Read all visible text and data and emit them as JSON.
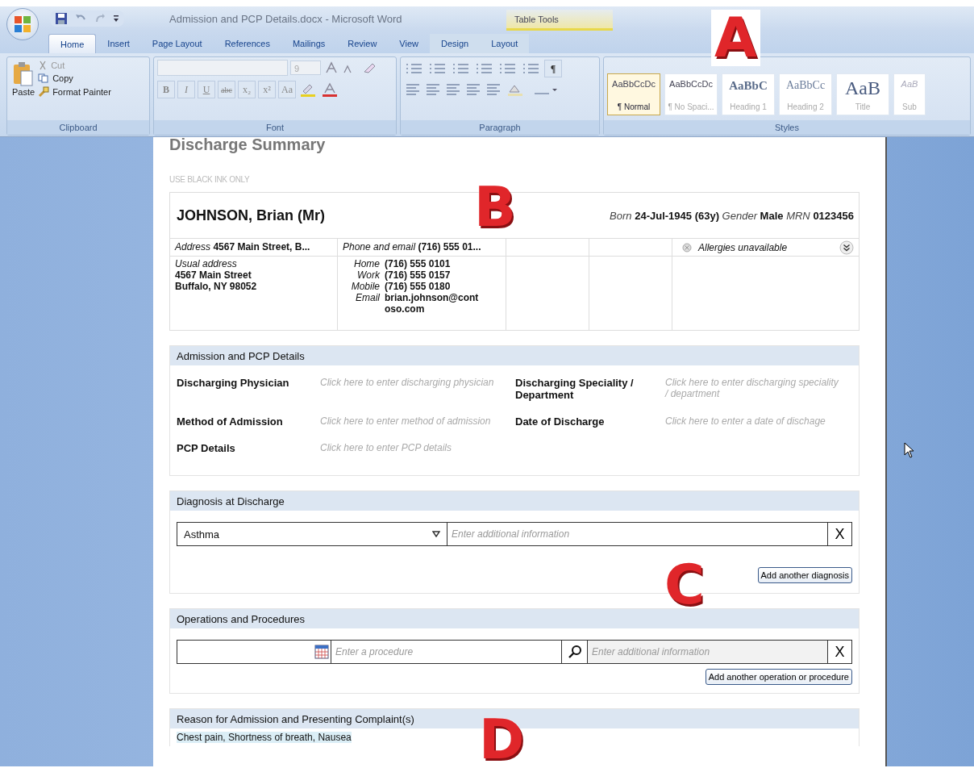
{
  "title_bar": {
    "title": "Admission and PCP Details.docx - Microsoft Word",
    "context_group": "Table Tools"
  },
  "ribbon_tabs": [
    {
      "label": "Home",
      "selected": true,
      "contextual": false
    },
    {
      "label": "Insert",
      "selected": false,
      "contextual": false
    },
    {
      "label": "Page Layout",
      "selected": false,
      "contextual": false
    },
    {
      "label": "References",
      "selected": false,
      "contextual": false
    },
    {
      "label": "Mailings",
      "selected": false,
      "contextual": false
    },
    {
      "label": "Review",
      "selected": false,
      "contextual": false
    },
    {
      "label": "View",
      "selected": false,
      "contextual": false
    },
    {
      "label": "Design",
      "selected": false,
      "contextual": true
    },
    {
      "label": "Layout",
      "selected": false,
      "contextual": true
    }
  ],
  "ribbon": {
    "clipboard": {
      "paste": "Paste",
      "items": [
        "Cut",
        "Copy",
        "Format Painter"
      ],
      "label": "Clipboard"
    },
    "font": {
      "size": "9",
      "format_buttons": [
        "B",
        "I",
        "U",
        "abc",
        "x₂",
        "x²",
        "Aa"
      ],
      "label": "Font"
    },
    "paragraph": {
      "pilcrow": "¶",
      "label": "Paragraph"
    },
    "styles": {
      "items": [
        {
          "preview": "AaBbCcDc",
          "name": "¶ Normal",
          "selected": true
        },
        {
          "preview": "AaBbCcDc",
          "name": "¶ No Spaci...",
          "selected": false
        },
        {
          "preview": "AaBbC",
          "name": "Heading 1",
          "selected": false
        },
        {
          "preview": "AaBbCc",
          "name": "Heading 2",
          "selected": false
        },
        {
          "preview": "AaB",
          "name": "Title",
          "selected": false
        },
        {
          "preview": "AaB",
          "name": "Sub",
          "selected": false
        }
      ],
      "label": "Styles"
    }
  },
  "document": {
    "heading": "Discharge Summary",
    "note": "USE BLACK INK ONLY",
    "patient": {
      "name": "JOHNSON, Brian (Mr)",
      "born_label": "Born",
      "born": "24-Jul-1945 (63y)",
      "gender_label": "Gender",
      "gender": "Male",
      "mrn_label": "MRN",
      "mrn": "0123456",
      "address_label": "Address",
      "address": "4567 Main Street, B...",
      "phone_label": "Phone and email",
      "phone": "(716) 555 01...",
      "allergies": "Allergies unavailable",
      "usual_address_label": "Usual address",
      "usual_address": [
        "4567 Main Street",
        "Buffalo, NY 98052"
      ],
      "contacts": [
        {
          "label": "Home",
          "value": "(716) 555 0101"
        },
        {
          "label": "Work",
          "value": "(716) 555 0157"
        },
        {
          "label": "Mobile",
          "value": "(716) 555 0180"
        },
        {
          "label": "Email",
          "value": "brian.johnson@contoso.com"
        }
      ]
    },
    "sections": [
      {
        "kind": "fields",
        "title": "Admission and PCP Details",
        "fields": [
          {
            "label": "Discharging Physician",
            "placeholder": "Click here to enter discharging physician"
          },
          {
            "label": "Discharging Speciality / Department",
            "placeholder": "Click here to enter discharging speciality / department"
          },
          {
            "label": "Method of Admission",
            "placeholder": "Click here to enter method of admission"
          },
          {
            "label": "Date of Discharge",
            "placeholder": "Click here to enter a date of dischage"
          },
          {
            "label": "PCP Details",
            "placeholder": "Click here to enter PCP details"
          }
        ]
      },
      {
        "kind": "diagnosis",
        "title": "Diagnosis at Discharge",
        "value": "Asthma",
        "info_placeholder": "Enter additional information",
        "remove": "X",
        "button": "Add another diagnosis"
      },
      {
        "kind": "procedure",
        "title": "Operations and Procedures",
        "procedure_placeholder": "Enter a procedure",
        "info_placeholder": "Enter additional information",
        "remove": "X",
        "button": "Add another operation or procedure"
      },
      {
        "kind": "complaint",
        "title": "Reason for Admission and Presenting Complaint(s)",
        "value": "Chest pain, Shortness of breath, Nausea"
      }
    ]
  },
  "callouts": [
    {
      "letter": "A"
    },
    {
      "letter": "B"
    },
    {
      "letter": "C"
    },
    {
      "letter": "D"
    }
  ]
}
